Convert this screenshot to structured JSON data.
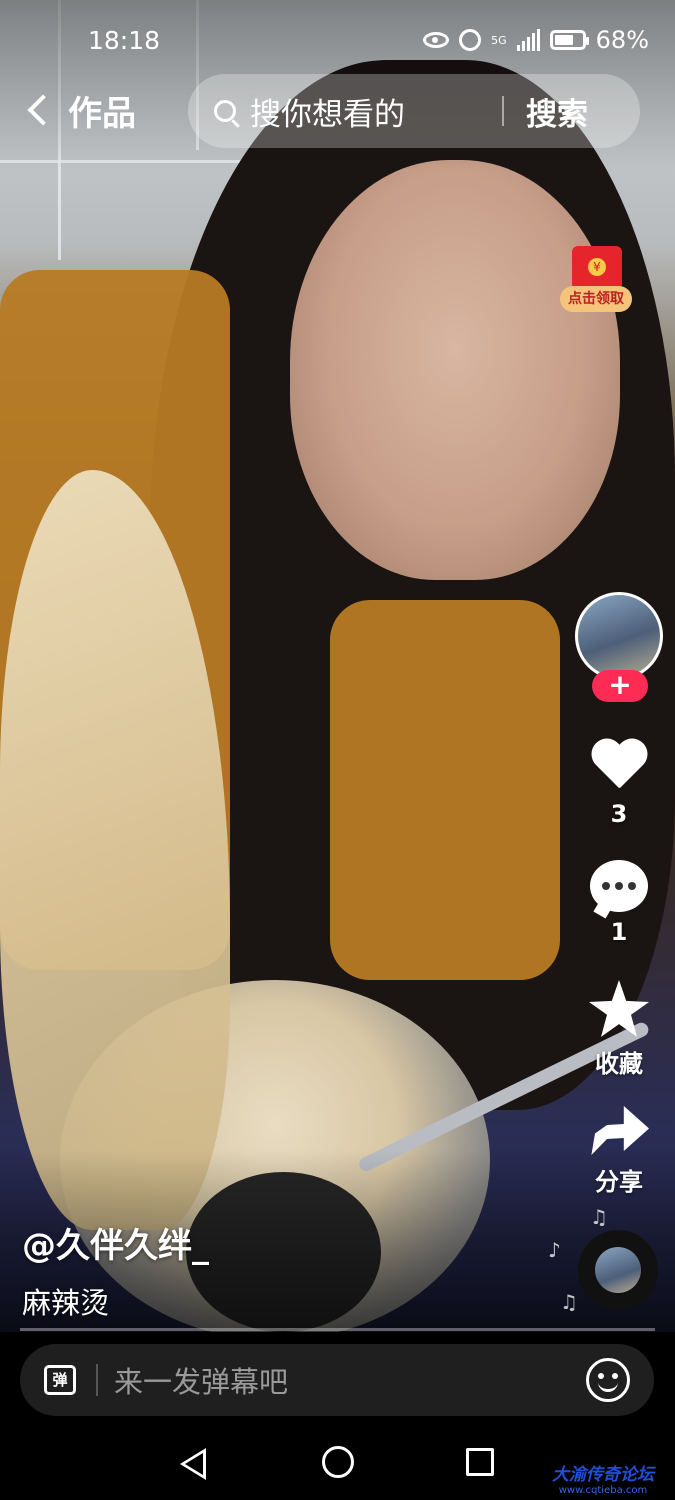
{
  "status_bar": {
    "time": "18:18",
    "network": "5G",
    "battery": "68%"
  },
  "top_bar": {
    "back_label": "作品",
    "search_placeholder": "搜你想看的",
    "search_button": "搜索"
  },
  "red_envelope": {
    "label": "点击领取",
    "coin_symbol": "¥"
  },
  "actions": {
    "follow_symbol": "+",
    "likes": "3",
    "comments": "1",
    "favorite_label": "收藏",
    "share_label": "分享"
  },
  "caption": {
    "author": "@久伴久绊_",
    "description": "麻辣烫"
  },
  "danmaku": {
    "icon_glyph": "弹",
    "placeholder": "来一发弹幕吧"
  },
  "watermark": {
    "title": "大渝传奇论坛",
    "url": "www.cqtieba.com"
  },
  "colors": {
    "accent": "#fe2c55",
    "envelope": "#e6242b",
    "watermark": "#1f4fd8"
  }
}
